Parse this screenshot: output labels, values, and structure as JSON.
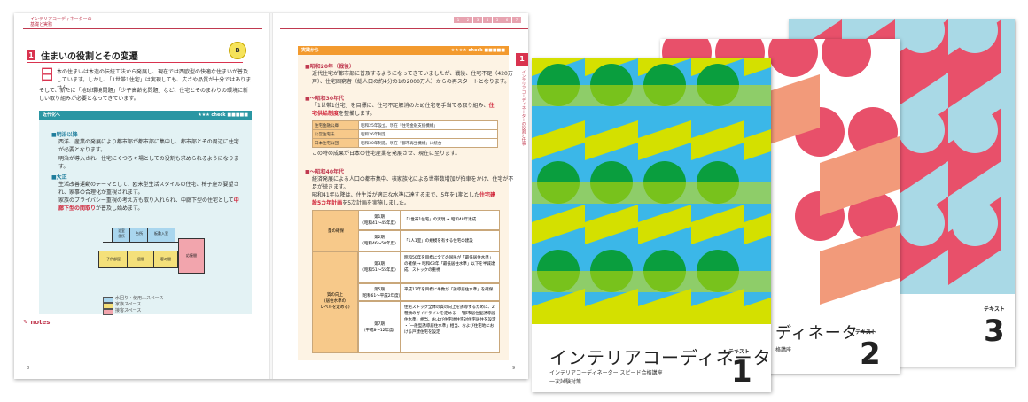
{
  "left_page": {
    "running_head": "インテリアコーディネーターの\n基礎と実務",
    "section_number": "1",
    "section_title": "住まいの役割とその変遷",
    "intro_drop_cap": "日",
    "intro_lines": [
      "本の住まいは木造の伝統工法から発展し、現在では西欧型の快適な住まいが普及しています。しかし、「1世帯1住宅」は実現しても、広さや品質が十分ではありません。",
      "そして、新たに「地球環境問題」「少子高齢化問題」など、住宅とそのまわりの環境に新しい取り組みが必要となってきています。"
    ],
    "box_title": "近代化へ",
    "box_check": "★★★ check ■■■■■",
    "meiji_heading": "■明治以降",
    "meiji_lines": [
      "西洋、産業の発展により都市部が都市部に集中し、都市部とその周辺に住宅が必要となります。",
      "明治が導入され、住宅にくつろぐ場としての役割も求められるようになります。"
    ],
    "taisho_heading": "■大正",
    "taisho_lines": [
      "生活改善運動のテーマとして、欧米型生活スタイルの住宅、椅子座が要望され、家事の合理化が重視されます。",
      "家族のプライバシー重視の考え方も取り入れられ、中廊下型の住宅として"
    ],
    "taisho_red": "中廊下型の間取り",
    "taisho_tail": "が普及し始めます。",
    "rooms": [
      "浴室\n便所",
      "台所",
      "板敷入室",
      "子供部屋",
      "居間",
      "客の間",
      "応接間"
    ],
    "legend": [
      "水回り・使用人スペース",
      "家族スペース",
      "接客スペース"
    ],
    "notes_label": "notes",
    "page_number": "8"
  },
  "right_page": {
    "box_title": "実践から",
    "box_check": "★★★★ check ■■■■■",
    "s1_heading": "■昭和20年（戦後）",
    "s1_lines": [
      "近代住宅が都市部に普及するようになってきていましたが、戦後、住宅不足（420万",
      "戸）、住宅困窮者（総人口の約4分の1の2000万人）からの再スタートとなります。"
    ],
    "s2_heading": "■〜昭和30年代",
    "s2_lines": [
      "「1世帯1住宅」を目標に、住宅不足解消のため住宅を手当てる取り組み、"
    ],
    "s2_red": "住宅供給制度",
    "s2_tail": "を整備します。",
    "table1": [
      [
        "住宅金融公庫",
        "昭和25年設立。現在「住宅金融支援機構」"
      ],
      [
        "公営住宅法",
        "昭和26年制定"
      ],
      [
        "日本住宅公団",
        "昭和30年制定。現在「都市再生機構」に統合"
      ]
    ],
    "s2_after": "この時の成果が日本の住宅産業を発展させ、現在に至ります。",
    "s3_heading": "■〜昭和40年代",
    "s3_lines": [
      "経済発展による人口の都市集中、核家族化による世帯数増加が拍車をかけ、住宅が不",
      "足が続きます。",
      "昭和41年以降は、住生活が適正な水準に達するまで、5年を1期とした"
    ],
    "s3_red": "住宅建設5カ年計画",
    "s3_tail": "を5次計画を実施しました。",
    "table2_col1": [
      "量の確保",
      "質の向上\n(居住水準の\nレベルを定める)"
    ],
    "table2_periods": [
      "第1期\n（昭和41〜45年度）",
      "第2期\n（昭和46〜50年度）",
      "第3期\n（昭和51〜55年度）",
      "第5期\n（昭和61〜平成2年度）",
      "第7期\n（平成8〜12年度）"
    ],
    "table2_notes": [
      "「1世帯1住宅」の実現 → 昭和48年達成",
      "「1人1室」の規模を有する住宅の建設",
      "昭和50年を目標に全ての国民が「最低居住水準」の確保 → 昭和63年「最低居住水準」以下を半減達成、ストックの重視",
      "平成12年を目標に半数が「誘導居住水準」を確保",
      "住宅ストック全体の質の向上を誘導するために、2種類のガイドラインを定める ・「都市居住型誘導居住水準」相当、および住宅地住宅対住宅居住を設定 ・「一般型誘導居住水準」相当、および住宅地における戸建住宅を設定"
    ],
    "side_tab_number": "1",
    "side_tab_text": "インテリアコーディネーターの役割と仕事",
    "page_number": "9",
    "nav_tabs": [
      "1",
      "2",
      "3",
      "4",
      "5",
      "6",
      "7"
    ]
  },
  "books": [
    {
      "title": "インテリアコーディネーター",
      "label": "テキスト",
      "number": "1",
      "subtitle_1": "インテリアコーディネーター スピード合格講座",
      "subtitle_2": "一次試験対策",
      "colors": {
        "bg": "#d4e000",
        "circle": "#3bb7e8",
        "accent": "#0a9e3e"
      }
    },
    {
      "title": "ディネーター",
      "label": "テキスト",
      "number": "2",
      "subtitle_1": "格講座",
      "colors": {
        "bg": "#f29a7a",
        "circle": "#e8506a",
        "accent": "#ffffff"
      }
    },
    {
      "title": "ディネーター",
      "label": "テキスト",
      "number": "3",
      "subtitle_1": "格講座",
      "colors": {
        "bg": "#a9d9e6",
        "circle": "#e8506a",
        "accent": "#ffffff"
      }
    }
  ]
}
